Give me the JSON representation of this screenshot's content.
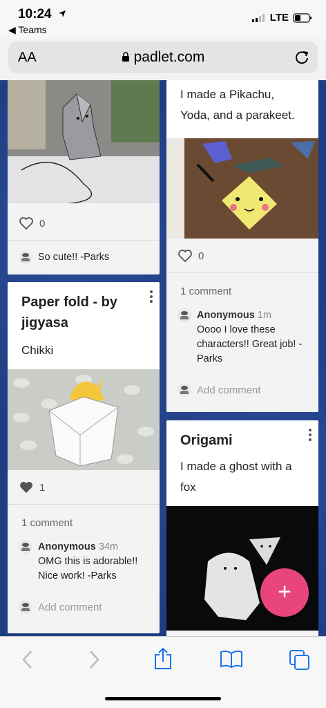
{
  "status": {
    "time": "10:24",
    "back_app": "Teams",
    "network": "LTE"
  },
  "browser": {
    "aa": "AA",
    "domain": "padlet.com"
  },
  "posts": {
    "left1": {
      "likes": "0",
      "comment": {
        "text": "So cute!! -Parks"
      }
    },
    "left2": {
      "title": "Paper fold - by jigyasa",
      "body": "Chikki",
      "likes": "1",
      "comment_count": "1 comment",
      "comment": {
        "author": "Anonymous",
        "ago": "34m",
        "text": "OMG this is adorable!! Nice work! -Parks"
      },
      "add_comment": "Add comment"
    },
    "right1": {
      "body": "I made a Pikachu, Yoda, and a parakeet.",
      "likes": "0",
      "comment_count": "1 comment",
      "comment": {
        "author": "Anonymous",
        "ago": "1m",
        "text": "Oooo I love these characters!! Great job! -Parks"
      },
      "add_comment": "Add comment"
    },
    "right2": {
      "title": "Origami",
      "body": "I made a ghost with a fox"
    }
  },
  "fab": {
    "label": "+"
  },
  "colors": {
    "board": "#1f3d82",
    "fab": "#e8457e",
    "accent": "#1a73e8"
  }
}
